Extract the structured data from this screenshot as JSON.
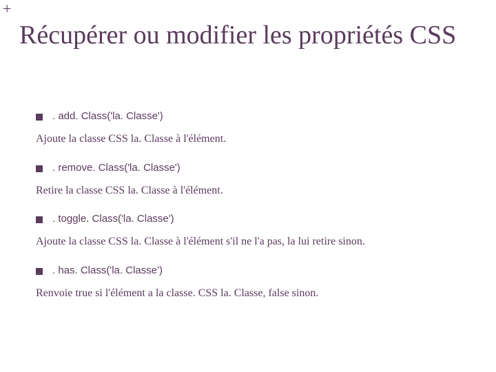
{
  "corner": "+",
  "title": "Récupérer ou modifier les propriétés CSS",
  "entries": [
    {
      "code": ". add. Class('la. Classe')",
      "desc": "Ajoute la classe CSS la. Classe à l'élément."
    },
    {
      "code": ". remove. Class('la. Classe')",
      "desc": "Retire la classe CSS la. Classe à l'élément."
    },
    {
      "code": ". toggle. Class('la. Classe')",
      "desc": "Ajoute la classe CSS la. Classe à l'élément s'il ne l'a pas, la lui retire sinon."
    },
    {
      "code": ". has. Class('la. Classe')",
      "desc": "Renvoie true si l'élément a la classe. CSS la. Classe, false sinon."
    }
  ]
}
